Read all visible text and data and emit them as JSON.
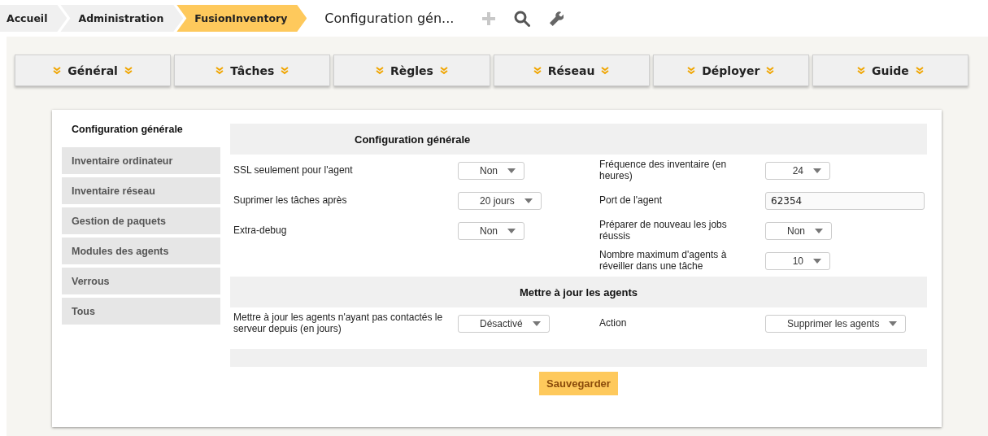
{
  "breadcrumb": [
    {
      "label": "Accueil",
      "selected": false
    },
    {
      "label": "Administration",
      "selected": false
    },
    {
      "label": "FusionInventory",
      "selected": true
    }
  ],
  "page_title": "Configuration gén...",
  "menu": [
    {
      "label": "Général"
    },
    {
      "label": "Tâches"
    },
    {
      "label": "Règles"
    },
    {
      "label": "Réseau"
    },
    {
      "label": "Déployer"
    },
    {
      "label": "Guide"
    }
  ],
  "sidebar": {
    "items": [
      {
        "label": "Configuration générale",
        "selected": true
      },
      {
        "label": "Inventaire ordinateur",
        "selected": false
      },
      {
        "label": "Inventaire réseau",
        "selected": false
      },
      {
        "label": "Gestion de paquets",
        "selected": false
      },
      {
        "label": "Modules des agents",
        "selected": false
      },
      {
        "label": "Verrous",
        "selected": false
      },
      {
        "label": "Tous",
        "selected": false
      }
    ]
  },
  "sections": [
    {
      "title": "Configuration générale",
      "rows": [
        {
          "left": {
            "label": "SSL seulement pour l'agent",
            "kind": "select",
            "value": "Non"
          },
          "right": {
            "label": "Fréquence des inventaire (en heures)",
            "kind": "select",
            "value": "24"
          }
        },
        {
          "left": {
            "label": "Suprimer les tâches après",
            "kind": "select",
            "value": "20 jours"
          },
          "right": {
            "label": "Port de l'agent",
            "kind": "text",
            "value": "62354"
          }
        },
        {
          "left": {
            "label": "Extra-debug",
            "kind": "select",
            "value": "Non"
          },
          "right": {
            "label": "Préparer de nouveau les jobs réussis",
            "kind": "select",
            "value": "Non"
          }
        },
        {
          "right": {
            "label": "Nombre maximum d'agents à réveiller dans une tâche",
            "kind": "select",
            "value": "10"
          }
        }
      ]
    },
    {
      "title": "Mettre à jour les agents",
      "rows": [
        {
          "left": {
            "label": "Mettre à jour les agents n'ayant pas contactés le serveur depuis (en jours)",
            "kind": "select",
            "value": "Désactivé"
          },
          "right": {
            "label": "Action",
            "kind": "select",
            "value": "Supprimer les agents"
          }
        }
      ]
    }
  ],
  "save_button": "Sauvegarder"
}
